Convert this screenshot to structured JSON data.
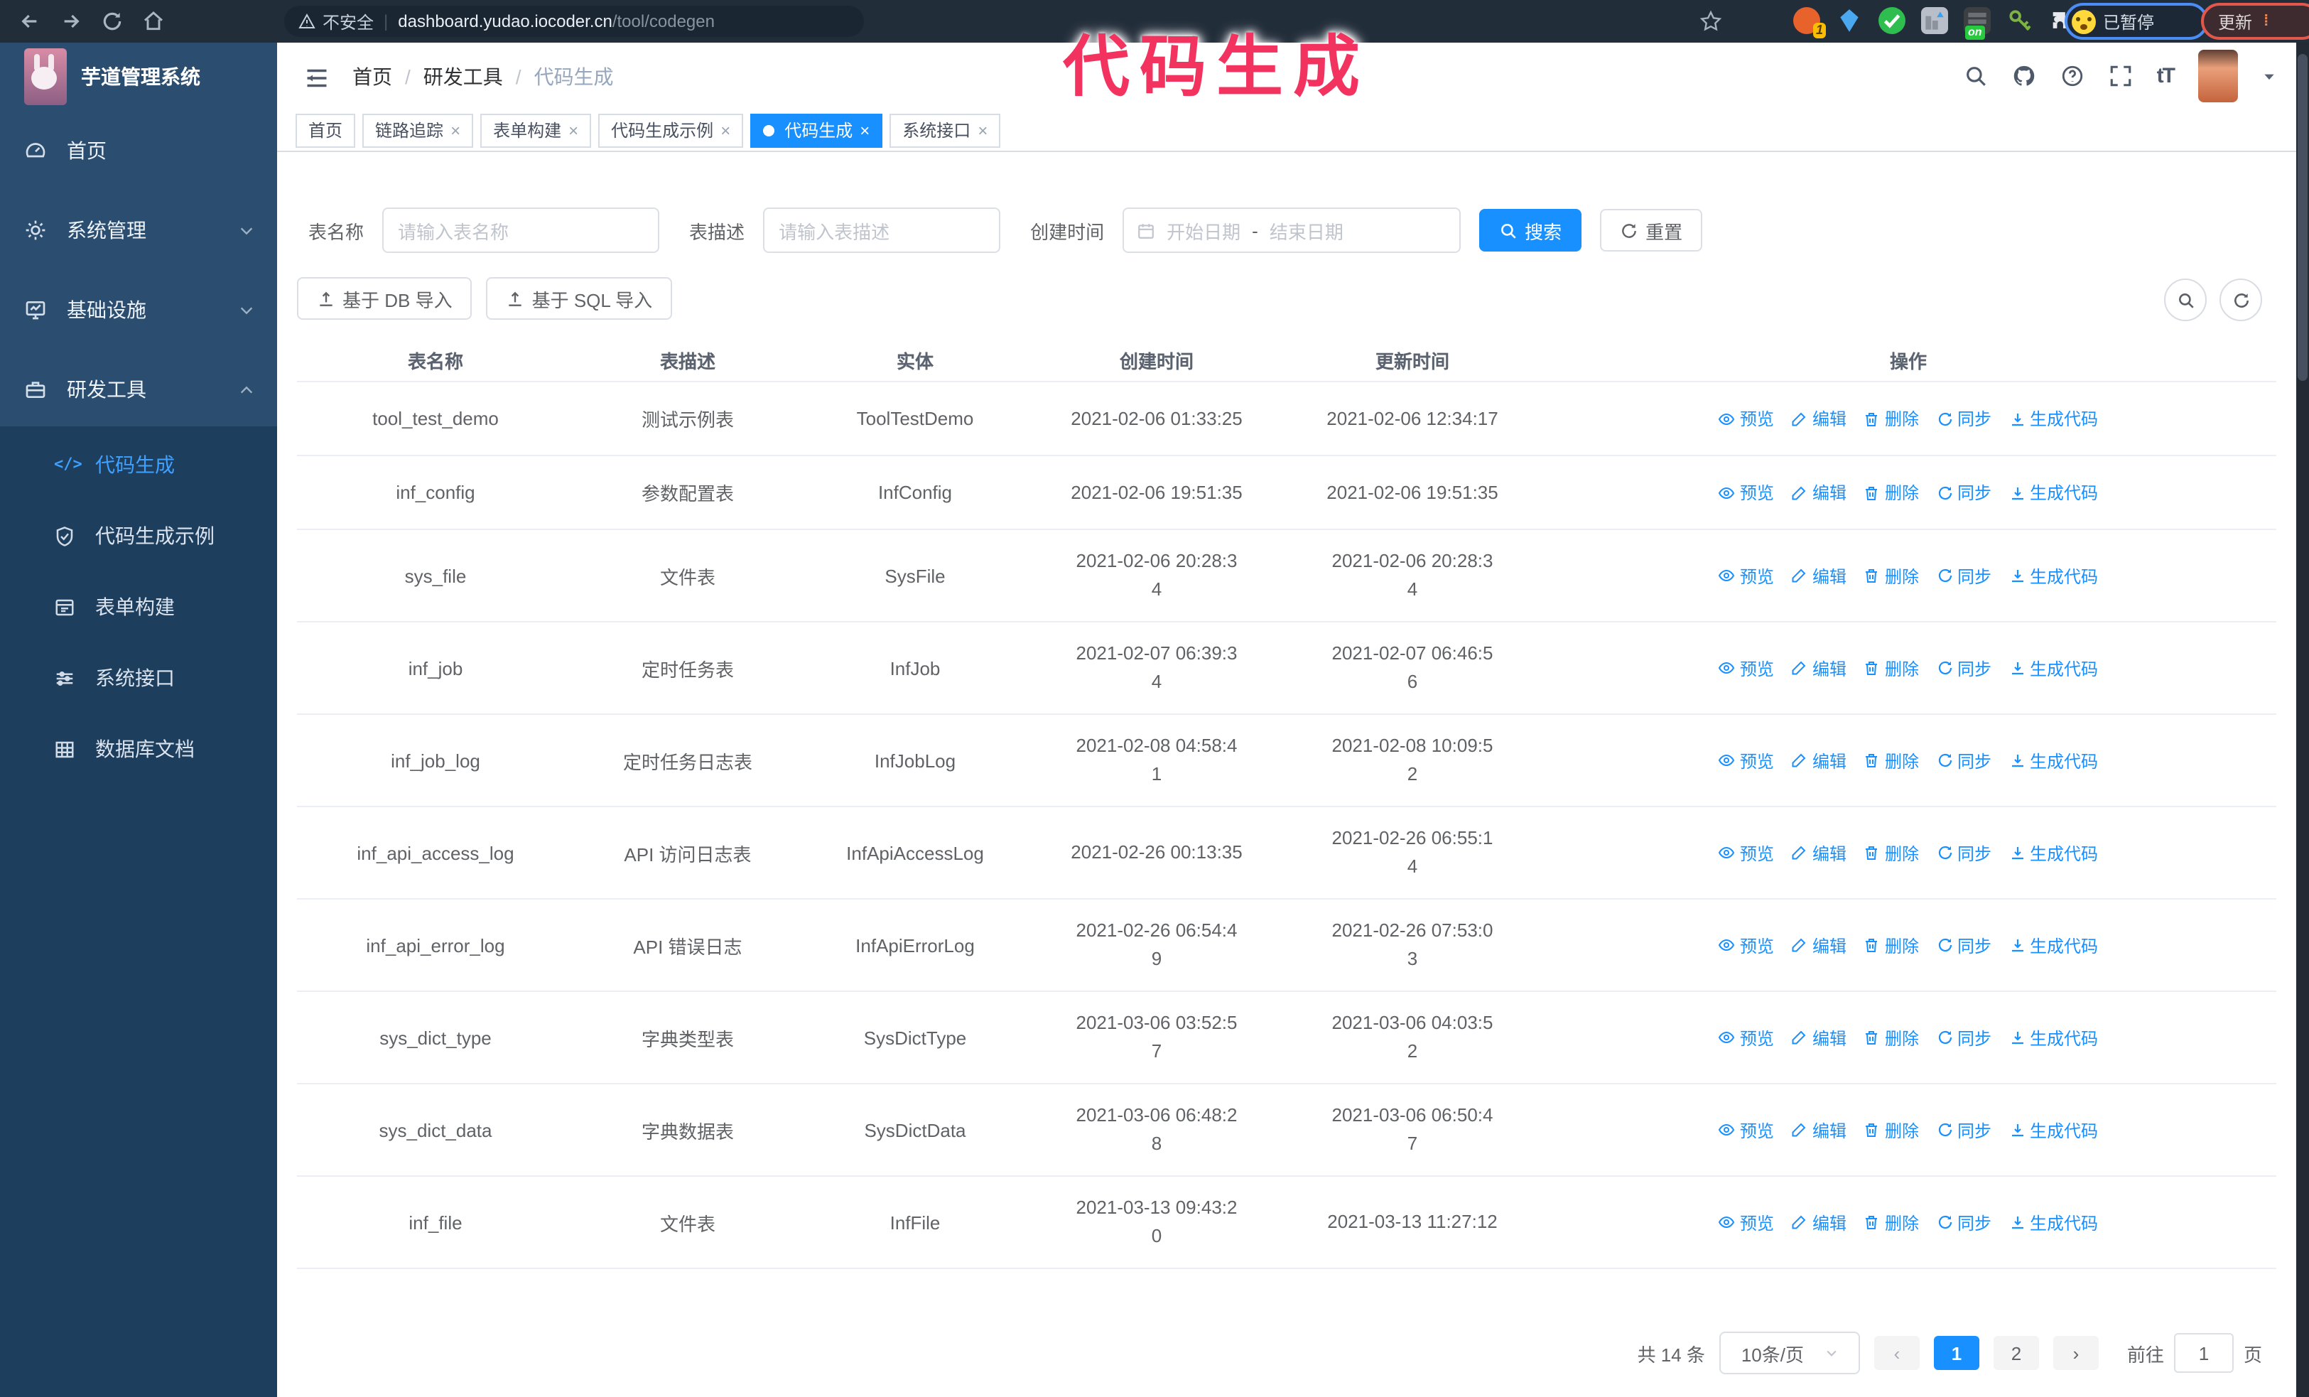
{
  "browser": {
    "security_label": "不安全",
    "url_host": "dashboard.yudao.iocoder.cn",
    "url_path": "/tool/codegen",
    "extension_badge_1": "1",
    "extension_on_badge": "on",
    "paused_badge": "已暂停",
    "update_button": "更新"
  },
  "annotation": {
    "text": "代码生成"
  },
  "app": {
    "title": "芋道管理系统"
  },
  "breadcrumb": {
    "items": [
      "首页",
      "研发工具",
      "代码生成"
    ]
  },
  "tabs": [
    {
      "label": "首页",
      "closable": false,
      "active": false
    },
    {
      "label": "链路追踪",
      "closable": true,
      "active": false
    },
    {
      "label": "表单构建",
      "closable": true,
      "active": false
    },
    {
      "label": "代码生成示例",
      "closable": true,
      "active": false
    },
    {
      "label": "代码生成",
      "closable": true,
      "active": true
    },
    {
      "label": "系统接口",
      "closable": true,
      "active": false
    }
  ],
  "sidebar": {
    "items": [
      {
        "label": "首页"
      },
      {
        "label": "系统管理"
      },
      {
        "label": "基础设施"
      },
      {
        "label": "研发工具"
      },
      {
        "label": "代码生成"
      },
      {
        "label": "代码生成示例"
      },
      {
        "label": "表单构建"
      },
      {
        "label": "系统接口"
      },
      {
        "label": "数据库文档"
      }
    ]
  },
  "filters": {
    "table_name_label": "表名称",
    "table_name_placeholder": "请输入表名称",
    "table_desc_label": "表描述",
    "table_desc_placeholder": "请输入表描述",
    "create_time_label": "创建时间",
    "date_start_placeholder": "开始日期",
    "date_separator": "-",
    "date_end_placeholder": "结束日期",
    "search_label": "搜索",
    "reset_label": "重置"
  },
  "toolbar": {
    "import_db_label": "基于 DB 导入",
    "import_sql_label": "基于 SQL 导入"
  },
  "table": {
    "headers": [
      "表名称",
      "表描述",
      "实体",
      "创建时间",
      "更新时间",
      "操作"
    ],
    "actions": [
      "预览",
      "编辑",
      "删除",
      "同步",
      "生成代码"
    ],
    "rows": [
      {
        "name": "tool_test_demo",
        "desc": "测试示例表",
        "entity": "ToolTestDemo",
        "created": "2021-02-06 01:33:25",
        "updated": "2021-02-06 12:34:17"
      },
      {
        "name": "inf_config",
        "desc": "参数配置表",
        "entity": "InfConfig",
        "created": "2021-02-06 19:51:35",
        "updated": "2021-02-06 19:51:35"
      },
      {
        "name": "sys_file",
        "desc": "文件表",
        "entity": "SysFile",
        "created": "2021-02-06 20:28:3\n4",
        "updated": "2021-02-06 20:28:3\n4"
      },
      {
        "name": "inf_job",
        "desc": "定时任务表",
        "entity": "InfJob",
        "created": "2021-02-07 06:39:3\n4",
        "updated": "2021-02-07 06:46:5\n6"
      },
      {
        "name": "inf_job_log",
        "desc": "定时任务日志表",
        "entity": "InfJobLog",
        "created": "2021-02-08 04:58:4\n1",
        "updated": "2021-02-08 10:09:5\n2"
      },
      {
        "name": "inf_api_access_log",
        "desc": "API 访问日志表",
        "entity": "InfApiAccessLog",
        "created": "2021-02-26 00:13:35",
        "updated": "2021-02-26 06:55:1\n4"
      },
      {
        "name": "inf_api_error_log",
        "desc": "API 错误日志",
        "entity": "InfApiErrorLog",
        "created": "2021-02-26 06:54:4\n9",
        "updated": "2021-02-26 07:53:0\n3"
      },
      {
        "name": "sys_dict_type",
        "desc": "字典类型表",
        "entity": "SysDictType",
        "created": "2021-03-06 03:52:5\n7",
        "updated": "2021-03-06 04:03:5\n2"
      },
      {
        "name": "sys_dict_data",
        "desc": "字典数据表",
        "entity": "SysDictData",
        "created": "2021-03-06 06:48:2\n8",
        "updated": "2021-03-06 06:50:4\n7"
      },
      {
        "name": "inf_file",
        "desc": "文件表",
        "entity": "InfFile",
        "created": "2021-03-13 09:43:2\n0",
        "updated": "2021-03-13 11:27:12"
      }
    ]
  },
  "pagination": {
    "total": "共 14 条",
    "page_size": "10条/页",
    "pages": [
      "1",
      "2"
    ],
    "goto_label": "前往",
    "goto_value": "1",
    "goto_suffix": "页"
  },
  "colors": {
    "accent": "#1890ff",
    "sidebar_bg": "#2b4e70",
    "submenu_bg": "#1e3e5e",
    "annotation": "#f2335f"
  }
}
